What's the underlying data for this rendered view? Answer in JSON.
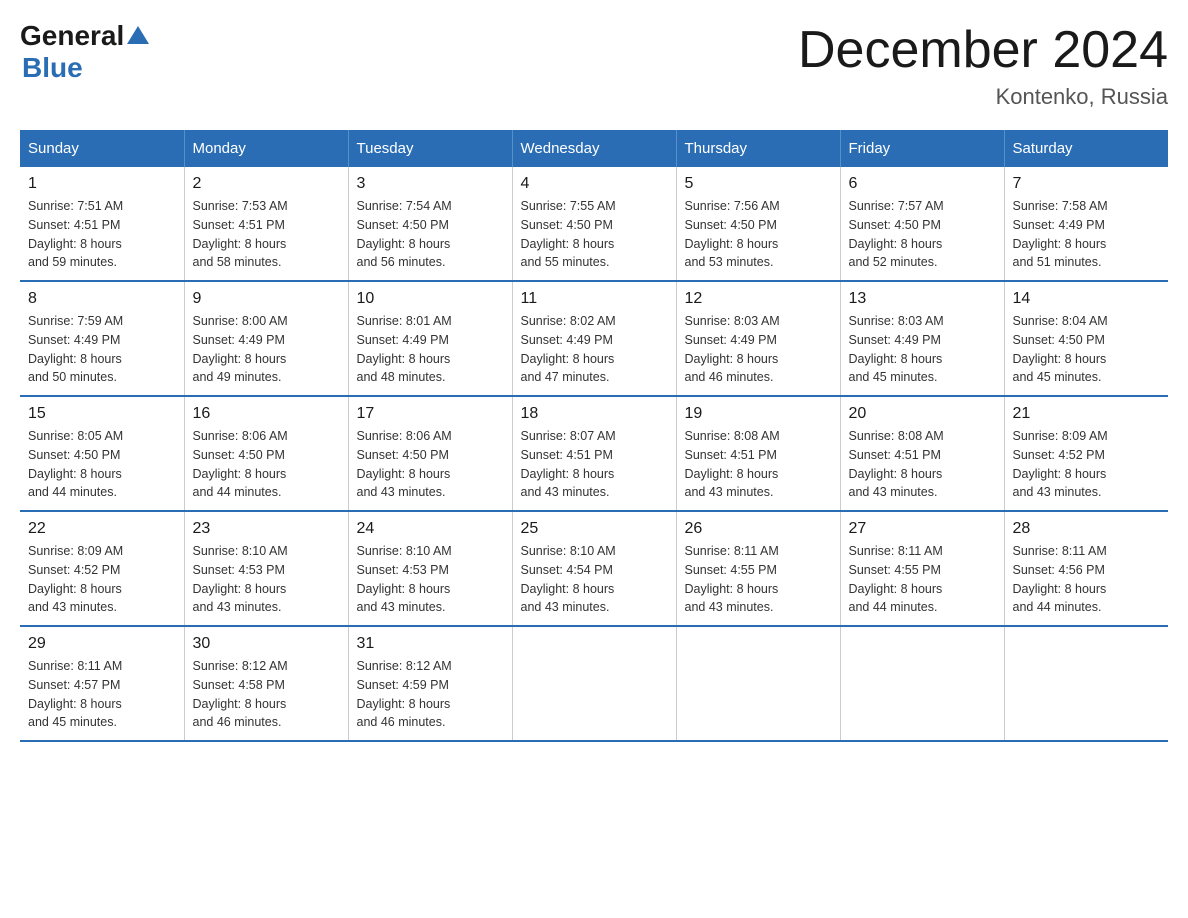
{
  "header": {
    "logo_general": "General",
    "logo_blue": "Blue",
    "month_title": "December 2024",
    "location": "Kontenko, Russia"
  },
  "days_of_week": [
    "Sunday",
    "Monday",
    "Tuesday",
    "Wednesday",
    "Thursday",
    "Friday",
    "Saturday"
  ],
  "weeks": [
    [
      {
        "day": "1",
        "sunrise": "7:51 AM",
        "sunset": "4:51 PM",
        "daylight": "8 hours and 59 minutes."
      },
      {
        "day": "2",
        "sunrise": "7:53 AM",
        "sunset": "4:51 PM",
        "daylight": "8 hours and 58 minutes."
      },
      {
        "day": "3",
        "sunrise": "7:54 AM",
        "sunset": "4:50 PM",
        "daylight": "8 hours and 56 minutes."
      },
      {
        "day": "4",
        "sunrise": "7:55 AM",
        "sunset": "4:50 PM",
        "daylight": "8 hours and 55 minutes."
      },
      {
        "day": "5",
        "sunrise": "7:56 AM",
        "sunset": "4:50 PM",
        "daylight": "8 hours and 53 minutes."
      },
      {
        "day": "6",
        "sunrise": "7:57 AM",
        "sunset": "4:50 PM",
        "daylight": "8 hours and 52 minutes."
      },
      {
        "day": "7",
        "sunrise": "7:58 AM",
        "sunset": "4:49 PM",
        "daylight": "8 hours and 51 minutes."
      }
    ],
    [
      {
        "day": "8",
        "sunrise": "7:59 AM",
        "sunset": "4:49 PM",
        "daylight": "8 hours and 50 minutes."
      },
      {
        "day": "9",
        "sunrise": "8:00 AM",
        "sunset": "4:49 PM",
        "daylight": "8 hours and 49 minutes."
      },
      {
        "day": "10",
        "sunrise": "8:01 AM",
        "sunset": "4:49 PM",
        "daylight": "8 hours and 48 minutes."
      },
      {
        "day": "11",
        "sunrise": "8:02 AM",
        "sunset": "4:49 PM",
        "daylight": "8 hours and 47 minutes."
      },
      {
        "day": "12",
        "sunrise": "8:03 AM",
        "sunset": "4:49 PM",
        "daylight": "8 hours and 46 minutes."
      },
      {
        "day": "13",
        "sunrise": "8:03 AM",
        "sunset": "4:49 PM",
        "daylight": "8 hours and 45 minutes."
      },
      {
        "day": "14",
        "sunrise": "8:04 AM",
        "sunset": "4:50 PM",
        "daylight": "8 hours and 45 minutes."
      }
    ],
    [
      {
        "day": "15",
        "sunrise": "8:05 AM",
        "sunset": "4:50 PM",
        "daylight": "8 hours and 44 minutes."
      },
      {
        "day": "16",
        "sunrise": "8:06 AM",
        "sunset": "4:50 PM",
        "daylight": "8 hours and 44 minutes."
      },
      {
        "day": "17",
        "sunrise": "8:06 AM",
        "sunset": "4:50 PM",
        "daylight": "8 hours and 43 minutes."
      },
      {
        "day": "18",
        "sunrise": "8:07 AM",
        "sunset": "4:51 PM",
        "daylight": "8 hours and 43 minutes."
      },
      {
        "day": "19",
        "sunrise": "8:08 AM",
        "sunset": "4:51 PM",
        "daylight": "8 hours and 43 minutes."
      },
      {
        "day": "20",
        "sunrise": "8:08 AM",
        "sunset": "4:51 PM",
        "daylight": "8 hours and 43 minutes."
      },
      {
        "day": "21",
        "sunrise": "8:09 AM",
        "sunset": "4:52 PM",
        "daylight": "8 hours and 43 minutes."
      }
    ],
    [
      {
        "day": "22",
        "sunrise": "8:09 AM",
        "sunset": "4:52 PM",
        "daylight": "8 hours and 43 minutes."
      },
      {
        "day": "23",
        "sunrise": "8:10 AM",
        "sunset": "4:53 PM",
        "daylight": "8 hours and 43 minutes."
      },
      {
        "day": "24",
        "sunrise": "8:10 AM",
        "sunset": "4:53 PM",
        "daylight": "8 hours and 43 minutes."
      },
      {
        "day": "25",
        "sunrise": "8:10 AM",
        "sunset": "4:54 PM",
        "daylight": "8 hours and 43 minutes."
      },
      {
        "day": "26",
        "sunrise": "8:11 AM",
        "sunset": "4:55 PM",
        "daylight": "8 hours and 43 minutes."
      },
      {
        "day": "27",
        "sunrise": "8:11 AM",
        "sunset": "4:55 PM",
        "daylight": "8 hours and 44 minutes."
      },
      {
        "day": "28",
        "sunrise": "8:11 AM",
        "sunset": "4:56 PM",
        "daylight": "8 hours and 44 minutes."
      }
    ],
    [
      {
        "day": "29",
        "sunrise": "8:11 AM",
        "sunset": "4:57 PM",
        "daylight": "8 hours and 45 minutes."
      },
      {
        "day": "30",
        "sunrise": "8:12 AM",
        "sunset": "4:58 PM",
        "daylight": "8 hours and 46 minutes."
      },
      {
        "day": "31",
        "sunrise": "8:12 AM",
        "sunset": "4:59 PM",
        "daylight": "8 hours and 46 minutes."
      },
      null,
      null,
      null,
      null
    ]
  ]
}
